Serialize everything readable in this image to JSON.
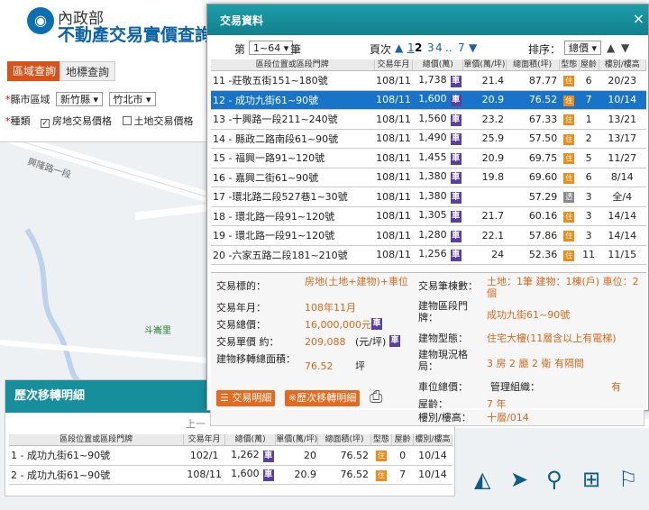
{
  "header": {
    "logo_line1": "內政部",
    "logo_line2": "不動產交易實價查詢"
  },
  "left_panel": {
    "tabs": [
      "區域查詢",
      "地標查詢"
    ],
    "county_label": "縣市區域",
    "county_value": "新竹縣",
    "district_value": "竹北市",
    "type_label": "種類",
    "type_options": [
      "房地交易價格",
      "土地交易價格"
    ]
  },
  "map_labels": {
    "road1": "興隆路一段",
    "village": "斗崙里"
  },
  "dialog": {
    "title": "交易資料",
    "close": "×",
    "range_prefix": "第",
    "range_value": "1~64",
    "range_suffix": "筆",
    "page_label": "頁次",
    "pages": [
      "1",
      "2",
      "3",
      "4",
      "..",
      "7"
    ],
    "sort_label": "排序：",
    "sort_value": "總價",
    "columns": [
      "區段位置或區段門牌",
      "交易年月",
      "總價(萬)",
      "單價(萬/坪)",
      "總面積(坪)",
      "型態",
      "屋齡",
      "樓別/樓高"
    ],
    "rows": [
      {
        "no": "11",
        "addr": "-莊敬五街151~180號",
        "ym": "108/11",
        "total": "1,738",
        "unit": "21.4",
        "area": "87.77",
        "type": "住",
        "age": "6",
        "floor": "20/23"
      },
      {
        "no": "12",
        "addr": "- 成功九街61~90號",
        "ym": "108/11",
        "total": "1,600",
        "unit": "20.9",
        "area": "76.52",
        "type": "住",
        "age": "7",
        "floor": "10/14"
      },
      {
        "no": "13",
        "addr": "-十興路一段211~240號",
        "ym": "108/11",
        "total": "1,560",
        "unit": "23.2",
        "area": "67.33",
        "type": "住",
        "age": "1",
        "floor": "13/21"
      },
      {
        "no": "14",
        "addr": "- 縣政二路南段61~90號",
        "ym": "108/11",
        "total": "1,490",
        "unit": "25.9",
        "area": "57.50",
        "type": "住",
        "age": "2",
        "floor": "13/17"
      },
      {
        "no": "15",
        "addr": "- 福興一路91~120號",
        "ym": "108/11",
        "total": "1,455",
        "unit": "20.9",
        "area": "69.75",
        "type": "住",
        "age": "5",
        "floor": "11/27"
      },
      {
        "no": "16",
        "addr": "- 嘉興二街61~90號",
        "ym": "108/11",
        "total": "1,380",
        "unit": "19.8",
        "area": "69.60",
        "type": "住",
        "age": "6",
        "floor": "8/14"
      },
      {
        "no": "17",
        "addr": "-環北路二段527巷1~30號",
        "ym": "108/11",
        "total": "1,380",
        "unit": "",
        "area": "57.29",
        "type": "透",
        "age": "3",
        "floor": "全/4"
      },
      {
        "no": "18",
        "addr": "- 環北路一段91~120號",
        "ym": "108/11",
        "total": "1,305",
        "unit": "21.7",
        "area": "60.16",
        "type": "住",
        "age": "3",
        "floor": "14/14"
      },
      {
        "no": "19",
        "addr": "- 環北路一段91~120號",
        "ym": "108/11",
        "total": "1,280",
        "unit": "22.1",
        "area": "57.86",
        "type": "住",
        "age": "3",
        "floor": "14/14"
      },
      {
        "no": "20",
        "addr": "-六家五路二段181~210號",
        "ym": "108/11",
        "total": "1,256",
        "unit": "24",
        "area": "52.36",
        "type": "住",
        "age": "11",
        "floor": "11/15"
      }
    ],
    "detail": {
      "target_label": "交易標的：",
      "target_value": "房地(土地+建物)+車位",
      "ym_label": "交易年月：",
      "ym_value": "108年11月",
      "total_label": "交易總價：",
      "total_value": "16,000,000元",
      "unit_label": "交易單價 約：",
      "unit_value": "209,088",
      "unit_unit": "(元/坪)",
      "area_label": "建物移轉總面積：",
      "area_value": "76.52",
      "area_unit": "坪",
      "count_label": "交易筆棟數：",
      "count_value": "土地：1筆 建物：1棟(戶) 車位：2個",
      "addr_label": "建物區段門牌：",
      "addr_value": "成功九街61~90號",
      "btype_label": "建物型態：",
      "btype_value": "住宅大樓(11層含以上有電梯)",
      "layout_label": "建物現況格局：",
      "layout_value": "3 房 2 廳 2 衛 有隔間",
      "park_label": "車位總價：",
      "mgmt_label": "管理組織：",
      "mgmt_value": "有",
      "age_label": "屋齡：",
      "age_value": "7 年",
      "floor_label": "樓別/樓高：",
      "floor_value": "十層/014",
      "btn_detail": "交易明細",
      "btn_history": "歷次移轉明細"
    }
  },
  "history": {
    "title": "歷次移轉明細",
    "pager": "上一",
    "rows": [
      {
        "no": "1",
        "addr": "- 成功九街61~90號",
        "ym": "102/1",
        "total": "1,262",
        "unit": "20",
        "area": "76.52",
        "type": "住",
        "age": "0",
        "floor": "10/14"
      },
      {
        "no": "2",
        "addr": "- 成功九街61~90號",
        "ym": "108/11",
        "total": "1,600",
        "unit": "20.9",
        "area": "76.52",
        "type": "住",
        "age": "7",
        "floor": "10/14"
      }
    ]
  },
  "colors": {
    "header_teal": "#178e9b",
    "selected_row": "#1874c8",
    "accent_orange": "#e46a1f",
    "car_badge": "#5a3fa0"
  },
  "map_tool_icons": [
    "measure-icon",
    "navigate-icon",
    "locate-icon",
    "grid-icon",
    "walk-icon"
  ]
}
